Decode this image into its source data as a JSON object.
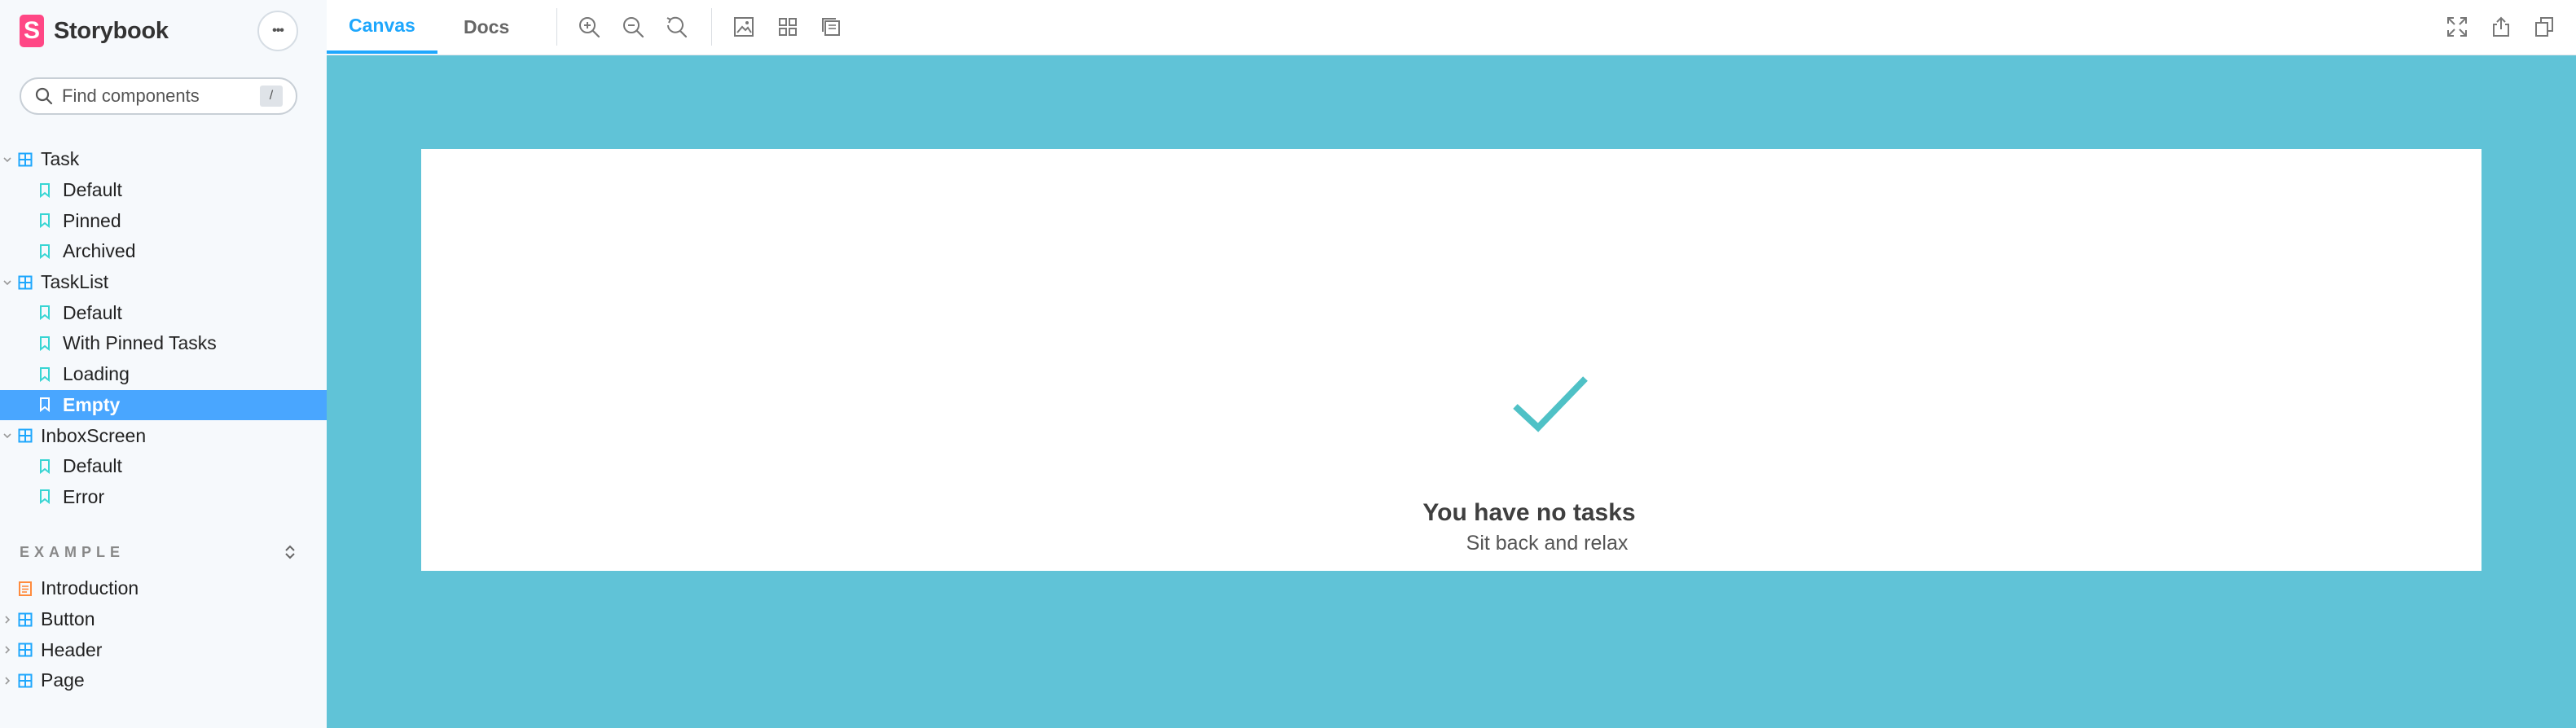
{
  "app": {
    "name": "Storybook",
    "logo_letter": "S",
    "more_label": "•••"
  },
  "search": {
    "placeholder": "Find components",
    "shortcut": "/"
  },
  "tree": {
    "task": {
      "label": "Task",
      "stories": [
        "Default",
        "Pinned",
        "Archived"
      ]
    },
    "tasklist": {
      "label": "TaskList",
      "stories": [
        "Default",
        "With Pinned Tasks",
        "Loading",
        "Empty"
      ]
    },
    "inbox": {
      "label": "InboxScreen",
      "stories": [
        "Default",
        "Error"
      ]
    }
  },
  "example": {
    "title": "EXAMPLE",
    "items": [
      "Introduction",
      "Button",
      "Header",
      "Page"
    ]
  },
  "toolbar": {
    "tabs": [
      "Canvas",
      "Docs"
    ]
  },
  "preview": {
    "title": "You have no tasks",
    "subtitle": "Sit back and relax"
  },
  "colors": {
    "accent": "#1ea7fd",
    "selection": "#49a6ff",
    "canvas": "#60c3d7",
    "check": "#4fc1c6",
    "brand": "#ff4785"
  }
}
